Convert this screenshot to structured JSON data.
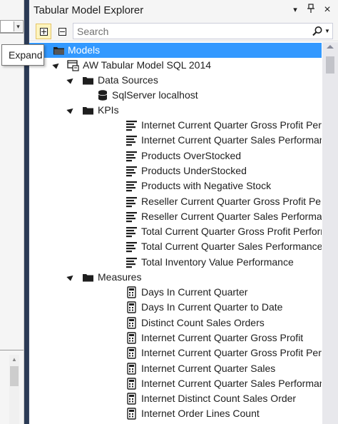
{
  "panel": {
    "title": "Tabular Model Explorer",
    "title_buttons": {
      "dropdown": "▾",
      "pin": "🖈",
      "close": "×"
    }
  },
  "toolbar": {
    "expand_icon": "expand-all-icon",
    "collapse_icon": "collapse-all-icon",
    "search_placeholder": "Search",
    "search_value": ""
  },
  "tooltip": {
    "text": "Expand"
  },
  "tree": {
    "root": {
      "label": "Models",
      "icon": "folder-icon",
      "selected": true
    },
    "model": {
      "label": "AW Tabular Model SQL 2014",
      "icon": "model-icon"
    },
    "data_sources": {
      "label": "Data Sources",
      "icon": "folder-icon",
      "items": [
        {
          "label": "SqlServer localhost",
          "icon": "database-icon"
        }
      ]
    },
    "kpis": {
      "label": "KPIs",
      "icon": "folder-icon",
      "items": [
        {
          "label": "Internet Current Quarter Gross Profit Performance"
        },
        {
          "label": "Internet Current Quarter Sales Performance"
        },
        {
          "label": "Products OverStocked"
        },
        {
          "label": "Products UnderStocked"
        },
        {
          "label": "Products with Negative Stock"
        },
        {
          "label": "Reseller Current Quarter Gross Profit Performance"
        },
        {
          "label": "Reseller Current Quarter Sales Performance"
        },
        {
          "label": "Total Current Quarter Gross Profit Performance"
        },
        {
          "label": "Total Current Quarter Sales Performance"
        },
        {
          "label": "Total Inventory Value Performance"
        }
      ]
    },
    "measures": {
      "label": "Measures",
      "icon": "folder-icon",
      "items": [
        {
          "label": "Days In Current Quarter"
        },
        {
          "label": "Days In Current Quarter to Date"
        },
        {
          "label": "Distinct Count Sales Orders"
        },
        {
          "label": "Internet Current Quarter Gross Profit"
        },
        {
          "label": "Internet Current Quarter Gross Profit Performance"
        },
        {
          "label": "Internet Current Quarter Sales"
        },
        {
          "label": "Internet Current Quarter Sales Performance"
        },
        {
          "label": "Internet Distinct Count Sales Order"
        },
        {
          "label": "Internet Order Lines Count"
        }
      ]
    }
  },
  "colors": {
    "selection": "#3399ff",
    "tooltip_border": "#767676",
    "active_button": "#fdf4bf"
  }
}
